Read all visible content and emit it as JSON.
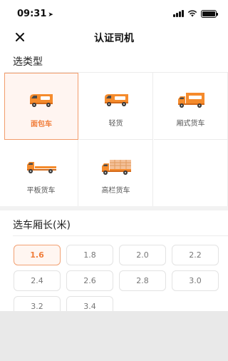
{
  "status": {
    "time": "09:31"
  },
  "nav": {
    "title": "认证司机"
  },
  "vehicle_section": {
    "label": "选类型",
    "types": [
      {
        "label": "面包车",
        "selected": true
      },
      {
        "label": "轻货",
        "selected": false
      },
      {
        "label": "厢式货车",
        "selected": false
      },
      {
        "label": "平板货车",
        "selected": false
      },
      {
        "label": "高栏货车",
        "selected": false
      }
    ]
  },
  "length_section": {
    "label": "选车厢长(米)",
    "options": [
      "1.6",
      "1.8",
      "2.0",
      "2.2",
      "2.4",
      "2.6",
      "2.8",
      "3.0",
      "3.2",
      "3.4"
    ],
    "selected_index": 0
  },
  "colors": {
    "accent": "#f07d3a",
    "truck_orange": "#f58b2c"
  }
}
